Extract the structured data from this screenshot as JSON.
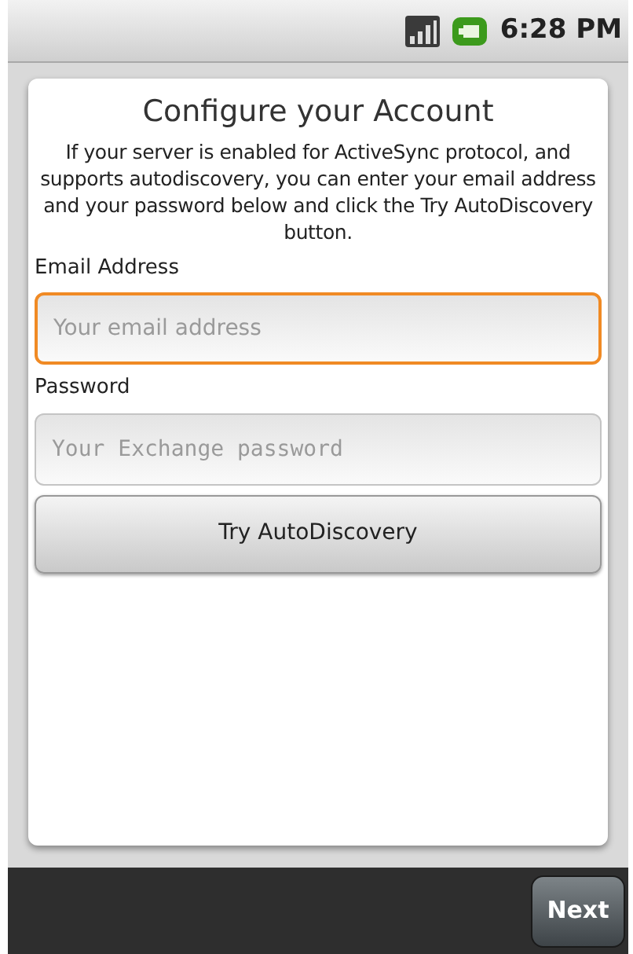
{
  "status_bar": {
    "time": "6:28 PM"
  },
  "title": "Configure your Account",
  "description": "If your server is enabled for ActiveSync protocol, and supports autodiscovery, you can enter your email address and your password below and click the Try AutoDiscovery button.",
  "fields": [
    {
      "label": "Email Address",
      "placeholder": "Your email address",
      "focused": true,
      "kind": "email"
    },
    {
      "label": "Password",
      "placeholder": "Your Exchange password",
      "focused": false,
      "kind": "password"
    }
  ],
  "autodiscover_button": "Try AutoDiscovery",
  "next_button": "Next"
}
